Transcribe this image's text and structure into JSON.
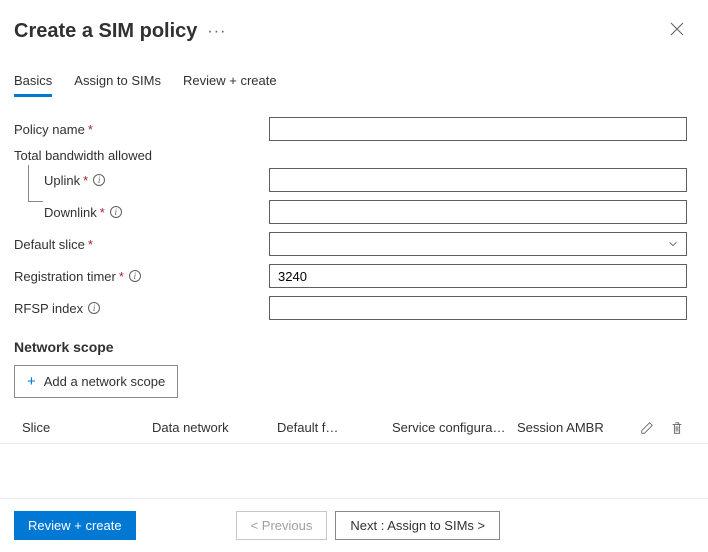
{
  "header": {
    "title": "Create a SIM policy",
    "ellipsis": "···"
  },
  "tabs": {
    "basics": "Basics",
    "assign": "Assign to SIMs",
    "review": "Review + create"
  },
  "form": {
    "policy_name": {
      "label": "Policy name",
      "value": ""
    },
    "bandwidth_group": "Total bandwidth allowed",
    "uplink": {
      "label": "Uplink",
      "value": ""
    },
    "downlink": {
      "label": "Downlink",
      "value": ""
    },
    "default_slice": {
      "label": "Default slice",
      "value": ""
    },
    "registration_timer": {
      "label": "Registration timer",
      "value": "3240"
    },
    "rfsp_index": {
      "label": "RFSP index",
      "value": ""
    }
  },
  "network_scope": {
    "heading": "Network scope",
    "add_button": "Add a network scope",
    "columns": {
      "slice": "Slice",
      "data_network": "Data network",
      "default_f": "Default f…",
      "service_config": "Service configura…",
      "session_ambr": "Session AMBR"
    }
  },
  "footer": {
    "review_create": "Review + create",
    "previous": "< Previous",
    "next": "Next : Assign to SIMs >"
  }
}
